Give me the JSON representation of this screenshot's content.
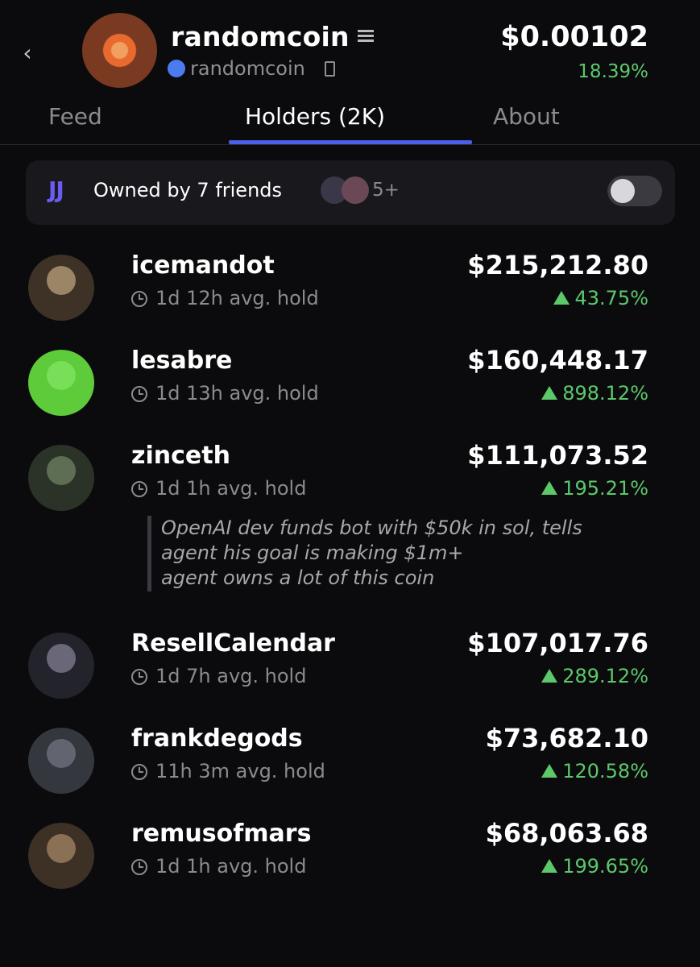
{
  "header": {
    "back_label": "‹",
    "coin_name": "randomcoin",
    "coin_ticker": "randomcoin",
    "price": "$0.00102",
    "change": "18.39%"
  },
  "tabs": [
    {
      "label": "Feed",
      "active": false
    },
    {
      "label": "Holders (2K)",
      "active": true
    },
    {
      "label": "About",
      "active": false
    }
  ],
  "friends": {
    "logo": "JJ",
    "text": "Owned by 7 friends",
    "more": "5+",
    "toggle_on": false
  },
  "holders": [
    {
      "name": "icemandot",
      "hold": "1d 12h avg. hold",
      "value": "$215,212.80",
      "change": "43.75%",
      "avatar_color": "#3e3226",
      "avatar_inner": "#9a8566"
    },
    {
      "name": "lesabre",
      "hold": "1d 13h avg. hold",
      "value": "$160,448.17",
      "change": "898.12%",
      "avatar_color": "#5ecb3a",
      "avatar_inner": "#78df58"
    },
    {
      "name": "zinceth",
      "hold": "1d 1h avg. hold",
      "value": "$111,073.52",
      "change": "195.21%",
      "avatar_color": "#2b3328",
      "avatar_inner": "#5e6e55"
    },
    {
      "name": "ResellCalendar",
      "hold": "1d 7h avg. hold",
      "value": "$107,017.76",
      "change": "289.12%",
      "avatar_color": "#23232b",
      "avatar_inner": "#6a6878"
    },
    {
      "name": "frankdegods",
      "hold": "11h 3m avg. hold",
      "value": "$73,682.10",
      "change": "120.58%",
      "avatar_color": "#34373e",
      "avatar_inner": "#62656f"
    },
    {
      "name": "remusofmars",
      "hold": "1d 1h avg. hold",
      "value": "$68,063.68",
      "change": "199.65%",
      "avatar_color": "#3d3024",
      "avatar_inner": "#8a7055"
    }
  ],
  "quote": {
    "lines": [
      "OpenAI dev funds bot with $50k in sol, tells",
      "agent his goal is making $1m+",
      "agent owns a lot of this coin"
    ]
  },
  "colors": {
    "accent": "#4a5ee8",
    "positive": "#5cc86a",
    "background": "#0b0b0e"
  }
}
